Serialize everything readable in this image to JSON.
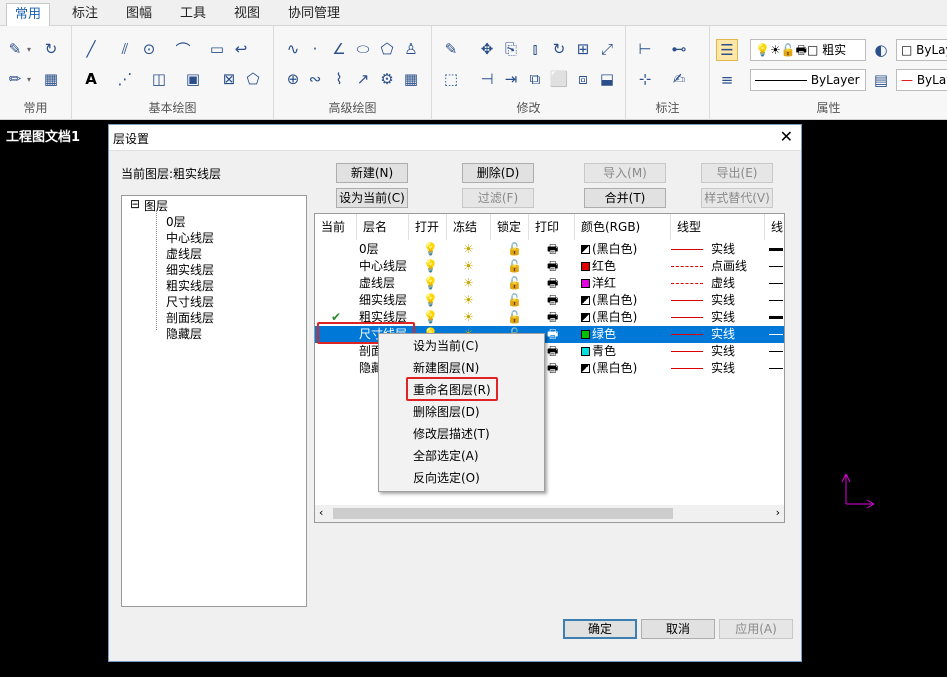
{
  "ribbon": {
    "tabs": [
      "常用",
      "标注",
      "图幅",
      "工具",
      "视图",
      "协同管理"
    ],
    "groups": [
      "常用",
      "基本绘图",
      "高级绘图",
      "修改",
      "标注",
      "属性"
    ],
    "layer_combo": "粗实",
    "color_combo": "ByLayer",
    "linetype_combo": "ByLayer",
    "lineweight_combo": "ByLay",
    "color_combo2": "ByLay"
  },
  "document_tab": "工程图文档1",
  "dialog": {
    "title": "层设置",
    "close": "✕",
    "current_layer_label": "当前图层:粗实线层",
    "buttons": {
      "new": "新建(N)",
      "delete": "删除(D)",
      "import": "导入(M)",
      "export": "导出(E)",
      "set_current": "设为当前(C)",
      "filter": "过滤(F)",
      "merge": "合并(T)",
      "style_override": "样式替代(V)",
      "ok": "确定",
      "cancel": "取消",
      "apply": "应用(A)"
    },
    "tree": {
      "root_toggle": "⊟",
      "root": "图层",
      "children": [
        "0层",
        "中心线层",
        "虚线层",
        "细实线层",
        "粗实线层",
        "尺寸线层",
        "剖面线层",
        "隐藏层"
      ]
    },
    "grid": {
      "columns": [
        "当前",
        "层名",
        "打开",
        "冻结",
        "锁定",
        "打印",
        "颜色(RGB)",
        "线型",
        "线"
      ],
      "rows": [
        {
          "current": "",
          "name": "0层",
          "color": "(黑白色)",
          "color_hex": "bw",
          "linetype": "实线",
          "lt_style": "solid",
          "lw": "thick"
        },
        {
          "current": "",
          "name": "中心线层",
          "color": "红色",
          "color_hex": "#e00000",
          "linetype": "点画线",
          "lt_style": "dashdot",
          "lw": "thin"
        },
        {
          "current": "",
          "name": "虚线层",
          "color": "洋红",
          "color_hex": "#e000e0",
          "linetype": "虚线",
          "lt_style": "dash",
          "lw": "thin"
        },
        {
          "current": "",
          "name": "细实线层",
          "color": "(黑白色)",
          "color_hex": "bw",
          "linetype": "实线",
          "lt_style": "solid",
          "lw": "thin"
        },
        {
          "current": "✔",
          "name": "粗实线层",
          "color": "(黑白色)",
          "color_hex": "bw",
          "linetype": "实线",
          "lt_style": "solid",
          "lw": "thick"
        },
        {
          "current": "",
          "name": "尺寸线层",
          "color": "绿色",
          "color_hex": "#00c000",
          "linetype": "实线",
          "lt_style": "solid",
          "lw": "thin"
        },
        {
          "current": "",
          "name": "剖面线层",
          "color": "青色",
          "color_hex": "#00e0e0",
          "linetype": "实线",
          "lt_style": "solid",
          "lw": "thin"
        },
        {
          "current": "",
          "name": "隐藏层",
          "color": "(黑白色)",
          "color_hex": "bw",
          "linetype": "实线",
          "lt_style": "solid",
          "lw": "thin"
        }
      ]
    }
  },
  "context_menu": [
    "设为当前(C)",
    "新建图层(N)",
    "重命名图层(R)",
    "删除图层(D)",
    "修改层描述(T)",
    "全部选定(A)",
    "反向选定(O)"
  ],
  "colors": {
    "selection": "#0078d7",
    "highlight_box": "#e02424",
    "ucs": "#e000e0"
  }
}
